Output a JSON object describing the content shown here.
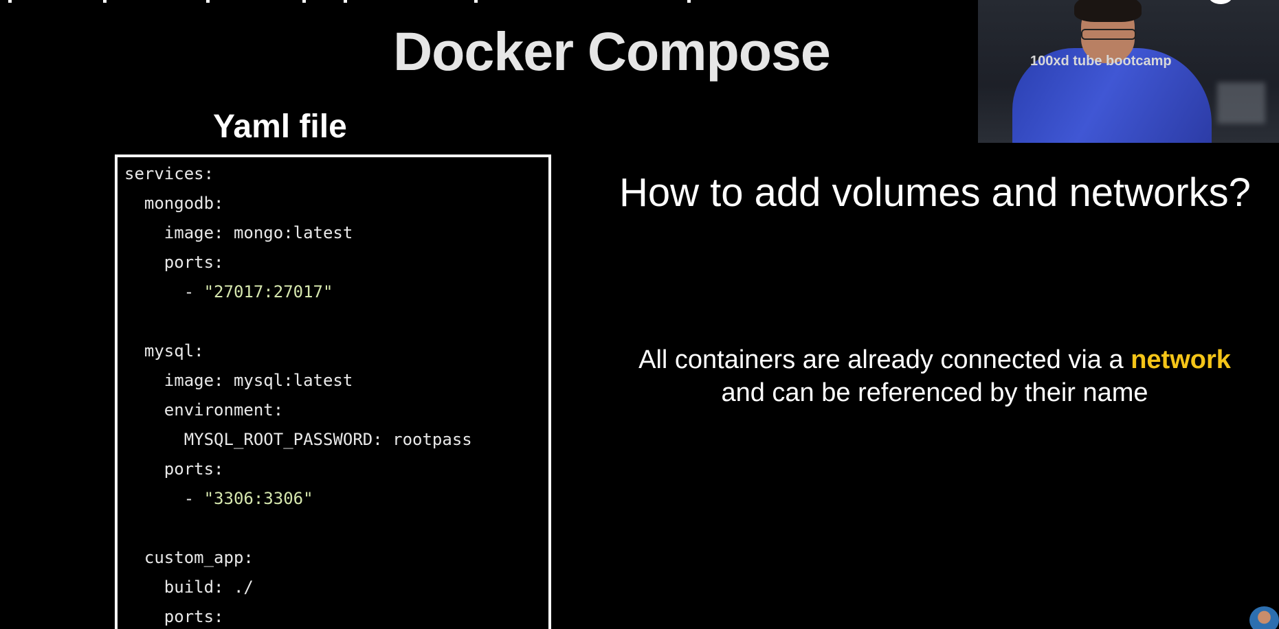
{
  "slide": {
    "title": "Docker Compose",
    "yaml_title": "Yaml file",
    "question": "How to add volumes and networks?",
    "body_line1_prefix": "All containers are already connected via a ",
    "body_line1_highlight": "network",
    "body_line2": "and can be referenced by their name"
  },
  "code": {
    "lines": [
      "services:",
      "  mongodb:",
      "    image: mongo:latest",
      "    ports:",
      "      - \"27017:27017\"",
      "",
      "  mysql:",
      "    image: mysql:latest",
      "    environment:",
      "      MYSQL_ROOT_PASSWORD: rootpass",
      "    ports:",
      "      - \"3306:3306\"",
      "",
      "  custom_app:",
      "    build: ./",
      "    ports:"
    ]
  },
  "webcam": {
    "overlay_text": "100xd  tube bootcamp"
  },
  "colors": {
    "background": "#000000",
    "highlight": "#f5c518",
    "string": "#d6e7ae"
  }
}
